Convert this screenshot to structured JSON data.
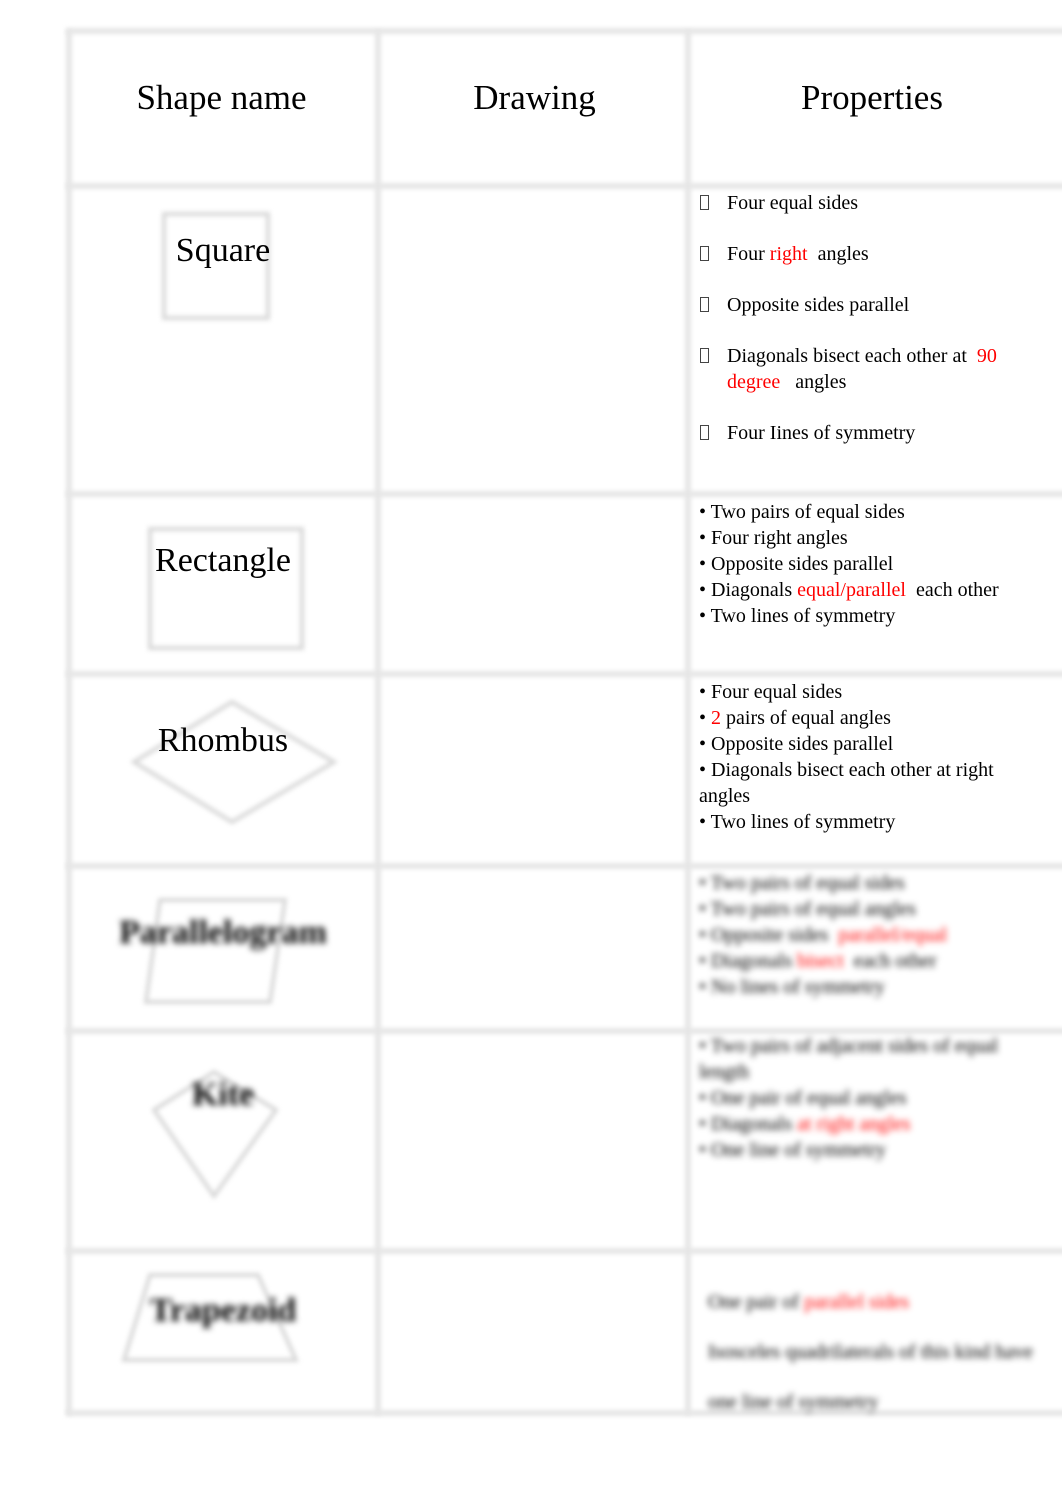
{
  "header": {
    "shape_name": "Shape name",
    "drawing": "Drawing",
    "properties": "Properties"
  },
  "rows": [
    {
      "name": "Square",
      "bullet": "box",
      "properties": [
        [
          {
            "t": "Four equal sides"
          }
        ],
        [
          {
            "t": "Four "
          },
          {
            "t": "right",
            "red": true
          },
          {
            "t": "  angles"
          }
        ],
        [
          {
            "t": "Opposite sides parallel"
          }
        ],
        [
          {
            "t": "Diagonals bisect each other at  "
          },
          {
            "t": "90 degree",
            "red": true
          },
          {
            "t": "   angles"
          }
        ],
        [
          {
            "t": "Four Iines of symmetry"
          }
        ]
      ]
    },
    {
      "name": "Rectangle",
      "bullet": "•",
      "properties": [
        [
          {
            "t": "Two pairs of equal sides"
          }
        ],
        [
          {
            "t": "Four right angles"
          }
        ],
        [
          {
            "t": "Opposite sides parallel"
          }
        ],
        [
          {
            "t": "Diagonals "
          },
          {
            "t": "equal/parallel",
            "red": true
          },
          {
            "t": "  each other"
          }
        ],
        [
          {
            "t": "Two lines of symmetry"
          }
        ]
      ]
    },
    {
      "name": "Rhombus",
      "bullet": "•",
      "properties": [
        [
          {
            "t": "Four equal sides"
          }
        ],
        [
          {
            "t": "2",
            "red": true
          },
          {
            "t": " pairs of equal angles"
          }
        ],
        [
          {
            "t": "Opposite sides parallel"
          }
        ],
        [
          {
            "t": "Diagonals bisect each other at right angles"
          }
        ],
        [
          {
            "t": "Two lines of symmetry"
          }
        ]
      ]
    },
    {
      "name": "Parallelogram",
      "bullet": "•",
      "blurred": true,
      "properties": [
        [
          {
            "t": "Two pairs of equal sides"
          }
        ],
        [
          {
            "t": "Two pairs of equal angles"
          }
        ],
        [
          {
            "t": "Opposite sides  "
          },
          {
            "t": "parallel/equal",
            "red": true
          }
        ],
        [
          {
            "t": "Diagonals "
          },
          {
            "t": "bisect",
            "red": true
          },
          {
            "t": "  each other"
          }
        ],
        [
          {
            "t": "No lines of symmetry"
          }
        ]
      ]
    },
    {
      "name": "Kite",
      "bullet": "•",
      "blurred": true,
      "properties": [
        [
          {
            "t": "Two pairs of adjacent sides of equal length"
          }
        ],
        [
          {
            "t": "One pair of equal angles"
          }
        ],
        [
          {
            "t": "Diagonals "
          },
          {
            "t": "at right angles",
            "red": true
          }
        ],
        [
          {
            "t": "One line of symmetry"
          }
        ]
      ]
    },
    {
      "name": "Trapezoid",
      "bullet": "",
      "blurred": true,
      "properties": [
        [
          {
            "t": "One pair of "
          },
          {
            "t": "parallel sides",
            "red": true
          }
        ],
        [
          {
            "t": "Isosceles quadrilaterals of this kind have one line of symmetry"
          }
        ]
      ]
    }
  ],
  "colors": {
    "highlight": "#ff0000",
    "grid": "#e6e6e6"
  }
}
